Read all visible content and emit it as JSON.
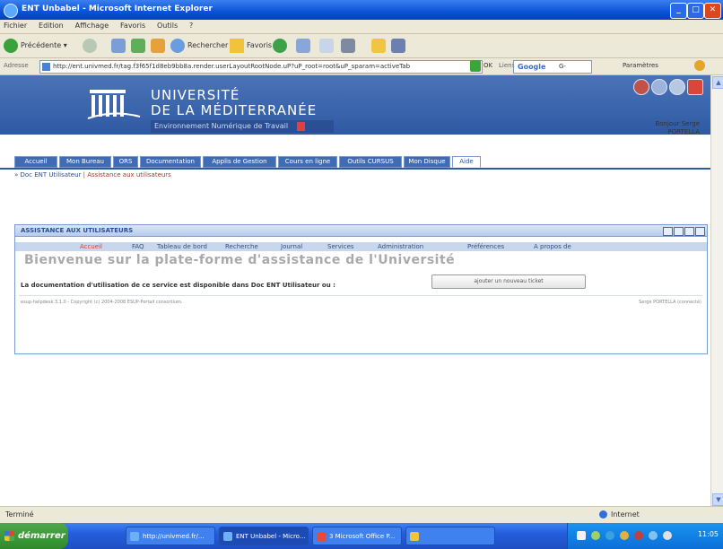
{
  "window": {
    "title": "ENT Unbabel - Microsoft Internet Explorer"
  },
  "menubar": [
    "Fichier",
    "Edition",
    "Affichage",
    "Favoris",
    "Outils",
    "?"
  ],
  "toolbar": {
    "back": "Précédente",
    "search": "Rechercher",
    "favorites": "Favoris"
  },
  "address": {
    "label": "Adresse",
    "url": "http://ent.univmed.fr/tag.f3f65f1d8eb9bb8a.render.userLayoutRootNode.uP?uP_root=root&uP_sparam=activeTab",
    "go": "OK",
    "links": "Liens",
    "google": "Google",
    "g_label": "G-",
    "params": "Paramètres"
  },
  "banner": {
    "line1": "UNIVERSITÉ",
    "line2": "DE LA MÉDITERRANÉE",
    "sub": "Environnement Numérique de Travail"
  },
  "greeting": {
    "line1": "Bonjour Serge",
    "line2": "PORTELLA"
  },
  "tabs": [
    "Accueil",
    "Mon Bureau",
    "ORS",
    "Documentation",
    "Applis de Gestion",
    "Cours en ligne",
    "Outils CURSUS",
    "Mon Disque",
    "Aide"
  ],
  "breadcrumb": {
    "first": "» Doc ENT Utilisateur",
    "separator": "|",
    "second": "Assistance aux utilisateurs"
  },
  "panel": {
    "title": "ASSISTANCE AUX UTILISATEURS",
    "subnav": [
      "Accueil",
      "FAQ",
      "Tableau de bord",
      "Recherche",
      "Journal",
      "Services",
      "Administration",
      "Préférences",
      "A propos de"
    ],
    "welcome": "Bienvenue sur la plate-forme d'assistance de l'Université",
    "doc_text": "La documentation d'utilisation de ce service est disponible dans Doc ENT Utilisateur ou :",
    "doc_button": "ajouter un nouveau ticket",
    "footer_left": "esup-helpdesk 3.1.0 - Copyright (c) 2004-2008 ESUP-Portail consortium.",
    "footer_right": "Serge PORTELLA (connecté)"
  },
  "status": {
    "left": "Terminé",
    "right": "Internet"
  },
  "taskbar": {
    "start": "démarrer",
    "tasks": [
      "http://univmed.fr/...",
      "ENT Unbabel - Micro...",
      "3 Microsoft Office P...",
      ""
    ],
    "clock": "11:05"
  },
  "colors": {
    "titlebar": "#0a52d6",
    "banner": "#3b65ae",
    "tab": "#3f6cb5",
    "accent": "#c04a2a",
    "start": "#3c9a36"
  }
}
